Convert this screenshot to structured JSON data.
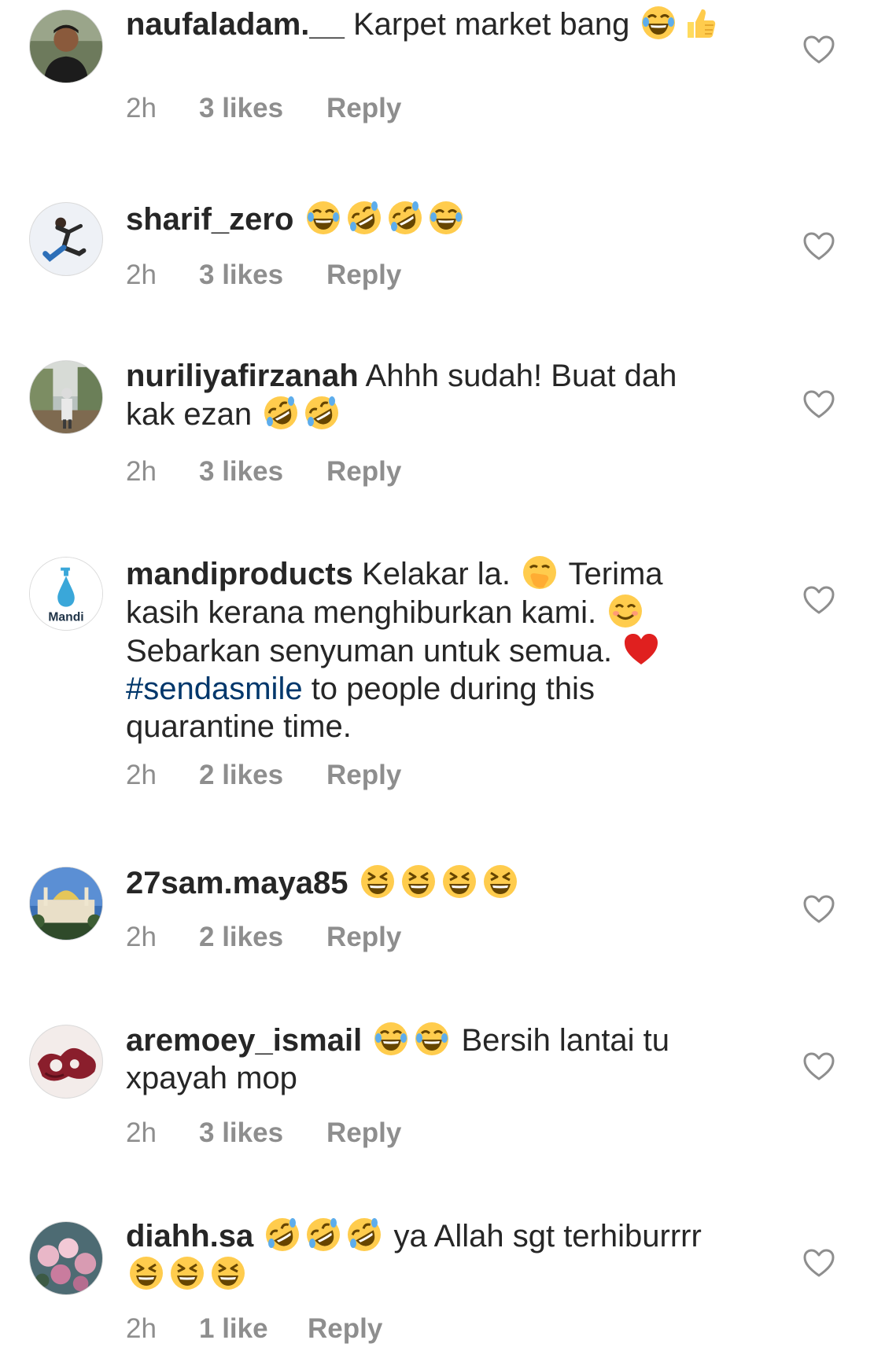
{
  "comments": [
    {
      "username": "naufaladam.__",
      "before": " Karpet market bang ",
      "emoji_a": [
        "joy-emoji"
      ],
      "after": "",
      "emoji_b": [
        "thumbs-up-emoji"
      ],
      "tail": "",
      "time": "2h",
      "likes": "3 likes",
      "reply": "Reply",
      "avatar": "avatar-photo-man-outdoors"
    },
    {
      "username": "sharif_zero",
      "before": " ",
      "emoji_a": [
        "joy-emoji",
        "rofl-emoji",
        "rofl-emoji",
        "joy-emoji"
      ],
      "after": "",
      "emoji_b": [],
      "tail": "",
      "time": "2h",
      "likes": "3 likes",
      "reply": "Reply",
      "avatar": "avatar-photo-person-jumping"
    },
    {
      "username": "nuriliyafirzanah",
      "before": " Ahhh sudah! Buat dah kak ezan ",
      "emoji_a": [
        "rofl-emoji",
        "rofl-emoji"
      ],
      "after": "",
      "emoji_b": [],
      "tail": "",
      "time": "2h",
      "likes": "3 likes",
      "reply": "Reply",
      "avatar": "avatar-photo-person-standing"
    },
    {
      "username": "mandiproducts",
      "before": " Kelakar la. ",
      "emoji_a": [
        "hand-over-mouth-emoji"
      ],
      "after": " Terima kasih kerana menghiburkan kami. ",
      "emoji_b": [
        "smiling-emoji"
      ],
      "mid": " Sebarkan senyuman untuk semua. ",
      "emoji_c": [
        "red-heart-emoji"
      ],
      "hashtag": "#sendasmile",
      "tail": " to people during this quarantine time.",
      "time": "2h",
      "likes": "2 likes",
      "reply": "Reply",
      "avatar": "avatar-mandi-logo",
      "logo_text": "Mandi"
    },
    {
      "username": "27sam.maya85",
      "before": " ",
      "emoji_a": [
        "grinning-squinting-emoji",
        "grinning-squinting-emoji",
        "grinning-squinting-emoji",
        "grinning-squinting-emoji"
      ],
      "after": "",
      "emoji_b": [],
      "tail": "",
      "time": "2h",
      "likes": "2 likes",
      "reply": "Reply",
      "avatar": "avatar-photo-mosque"
    },
    {
      "username": "aremoey_ismail",
      "before": " ",
      "emoji_a": [
        "joy-emoji",
        "joy-emoji"
      ],
      "after": " Bersih lantai tu xpayah mop",
      "emoji_b": [],
      "tail": "",
      "time": "2h",
      "likes": "3 likes",
      "reply": "Reply",
      "avatar": "avatar-photo-red-art"
    },
    {
      "username": "diahh.sa",
      "before": " ",
      "emoji_a": [
        "rofl-emoji",
        "rofl-emoji",
        "rofl-emoji"
      ],
      "after": " ya Allah sgt terhiburrrr",
      "emoji_b": [
        "grinning-squinting-emoji",
        "grinning-squinting-emoji",
        "grinning-squinting-emoji"
      ],
      "tail": "",
      "time": "2h",
      "likes": "1 like",
      "reply": "Reply",
      "avatar": "avatar-photo-roses"
    }
  ],
  "colors": {
    "text": "#262626",
    "meta": "#8e8e8e",
    "hashtag": "#00376b",
    "heart_outline": "#8e8e8e",
    "emoji_yellow": "#ffcc4d",
    "heart_red": "#e0201f"
  }
}
